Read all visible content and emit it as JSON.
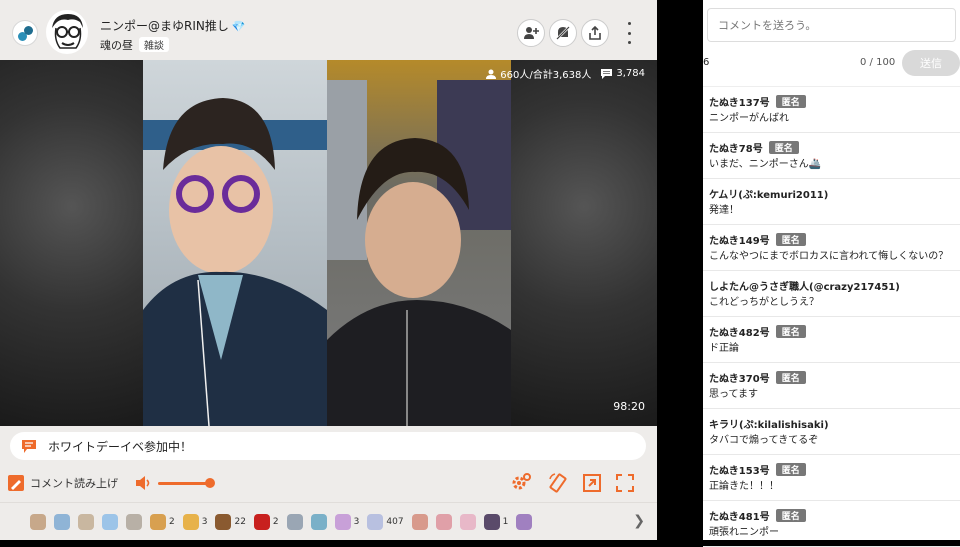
{
  "colors": {
    "accent": "#ee6b2c",
    "badge": "#777777",
    "send_button": "#d9d9d9"
  },
  "header": {
    "title": "ニンポー@まゆRIN推し",
    "subtitle": "魂の昼",
    "tag": "雑談",
    "buttons": [
      "add-user-icon",
      "mute-icon",
      "share-icon",
      "more-icon"
    ]
  },
  "video": {
    "viewers": "660人/合計3,638人",
    "comments": "3,784",
    "duration": "98:20"
  },
  "info_bar": {
    "text": "ホワイトデーイベ参加中！"
  },
  "controls": {
    "tts_label": "コメント読み上げ",
    "volume": 1.0
  },
  "gifts": [
    {
      "count": "",
      "color": "#c7a88a"
    },
    {
      "count": "",
      "color": "#8fb4d6"
    },
    {
      "count": "",
      "color": "#c9b7a0"
    },
    {
      "count": "",
      "color": "#9cc4e8"
    },
    {
      "count": "",
      "color": "#b8b0a6"
    },
    {
      "count": "2",
      "color": "#d8a050"
    },
    {
      "count": "3",
      "color": "#e7b24a"
    },
    {
      "count": "22",
      "color": "#8a5a30"
    },
    {
      "count": "2",
      "color": "#c8201e"
    },
    {
      "count": "",
      "color": "#9aa6b4"
    },
    {
      "count": "",
      "color": "#7ab0c8"
    },
    {
      "count": "3",
      "color": "#c8a0d8"
    },
    {
      "count": "407",
      "color": "#b8c0e0"
    },
    {
      "count": "",
      "color": "#d89a8c"
    },
    {
      "count": "",
      "color": "#e0a0a8"
    },
    {
      "count": "",
      "color": "#e8b8c8"
    },
    {
      "count": "1",
      "color": "#5a4a6a"
    },
    {
      "count": "",
      "color": "#a080c0"
    }
  ],
  "chat": {
    "placeholder": "コメントを送ろう。",
    "char_count": "0 / 100",
    "send_label": "送信",
    "side_number": "6",
    "comments": [
      {
        "user": "たぬき137号",
        "anon": "匿名",
        "text": "ニンポーがんばれ"
      },
      {
        "user": "たぬき78号",
        "anon": "匿名",
        "text": "いまだ、ニンポーさん🚢"
      },
      {
        "user": "ケムリ(ぷ:kemuri2011)",
        "anon": "",
        "text": "発達！"
      },
      {
        "user": "たぬき149号",
        "anon": "匿名",
        "text": "こんなやつにまでボロカスに言われて悔しくないの？"
      },
      {
        "user": "しよたん@うさぎ職人(@crazy217451)",
        "anon": "",
        "text": "これどっちがとしうえ？"
      },
      {
        "user": "たぬき482号",
        "anon": "匿名",
        "text": "ド正論"
      },
      {
        "user": "たぬき370号",
        "anon": "匿名",
        "text": "思ってます"
      },
      {
        "user": "キラリ(ぷ:kilalishisaki)",
        "anon": "",
        "text": "タバコで煽ってきてるぞ"
      },
      {
        "user": "たぬき153号",
        "anon": "匿名",
        "text": "正論きた！！！"
      },
      {
        "user": "たぬき481号",
        "anon": "匿名",
        "text": "頑張れニンポー"
      }
    ]
  }
}
